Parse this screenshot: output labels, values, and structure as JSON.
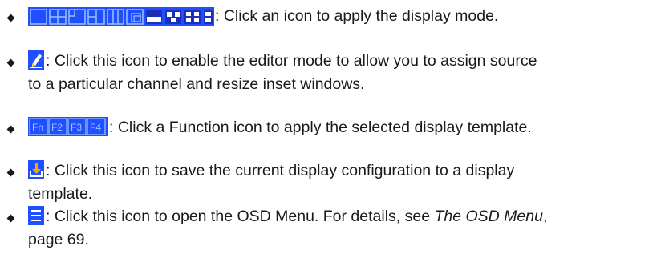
{
  "colors": {
    "icon_blue": "#1f4fff",
    "icon_dark": "#1b2fb8",
    "icon_light": "#8fb4ff",
    "text": "#1a1a1a",
    "accent_orange": "#f7a600",
    "accent_yellow": "#f0e000"
  },
  "items": [
    {
      "icons": [
        "display-mode-icons"
      ],
      "text": ": Click an icon to apply the display mode."
    },
    {
      "icons": [
        "pencil-editor-icon"
      ],
      "text": ": Click this icon to enable the editor mode to allow you to assign source",
      "text2": "to a particular channel and resize inset windows."
    },
    {
      "icons": [
        "function-f1-icon",
        "function-f2-icon",
        "function-f3-icon",
        "function-f4-icon"
      ],
      "text": ": Click a Function icon to apply the selected display template."
    },
    {
      "icons": [
        "save-download-icon"
      ],
      "text": ": Click this icon to save the current display configuration to a display",
      "text2": "template."
    },
    {
      "icons": [
        "menu-lines-icon"
      ],
      "text_a": ": Click this icon to open the OSD Menu. For details, see ",
      "text_em": "The OSD Menu",
      "text_b": ",",
      "text2": "page 69."
    }
  ]
}
